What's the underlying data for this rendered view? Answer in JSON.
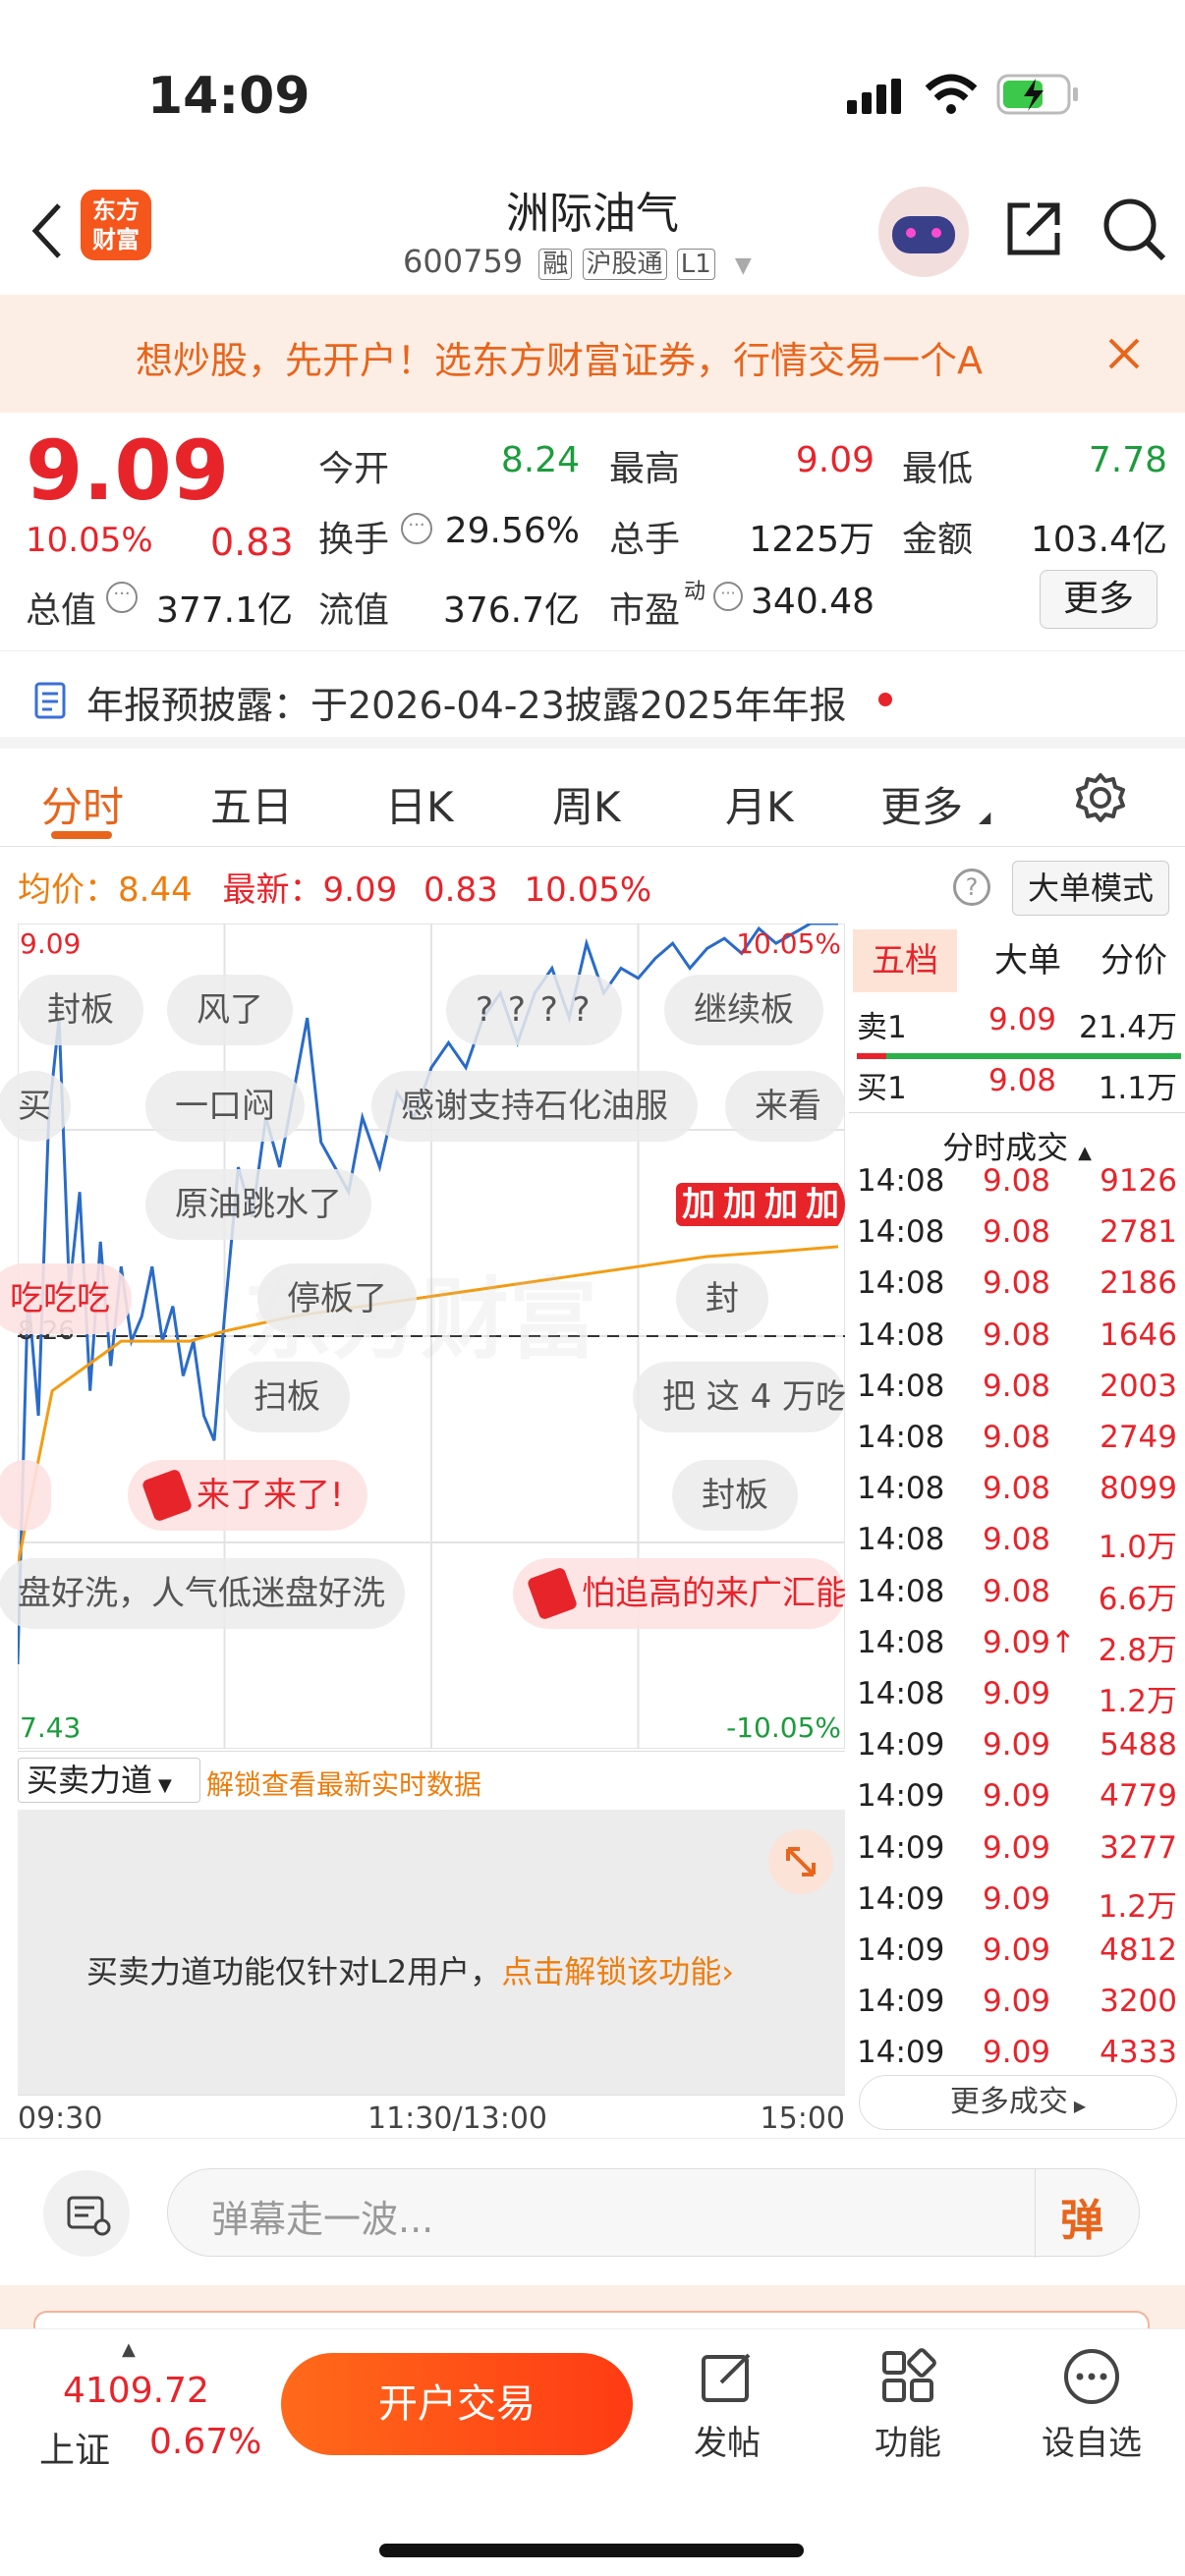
{
  "status": {
    "time": "14:09"
  },
  "header": {
    "title": "洲际油气",
    "code": "600759",
    "tags": [
      "融",
      "沪股通",
      "L1"
    ],
    "logo": "东方财富"
  },
  "banner": {
    "text": "想炒股，先开户！选东方财富证券，行情交易一个A"
  },
  "quote": {
    "price": "9.09",
    "pct": "10.05%",
    "change": "0.83",
    "fields": [
      {
        "label": "今开",
        "value": "8.24",
        "color": "#1c9c3c"
      },
      {
        "label": "最高",
        "value": "9.09",
        "color": "#e8242b"
      },
      {
        "label": "最低",
        "value": "7.78",
        "color": "#1c9c3c"
      },
      {
        "label": "换手",
        "value": "29.56%",
        "color": "#222"
      },
      {
        "label": "总手",
        "value": "1225万",
        "color": "#222"
      },
      {
        "label": "金额",
        "value": "103.4亿",
        "color": "#222"
      },
      {
        "label": "总值",
        "value": "377.1亿",
        "color": "#222"
      },
      {
        "label": "流值",
        "value": "376.7亿",
        "color": "#222"
      },
      {
        "label": "市盈",
        "value": "340.48",
        "color": "#222",
        "sup": "动"
      }
    ],
    "more": "更多"
  },
  "notice": {
    "text": "年报预披露：于2026-04-23披露2025年年报"
  },
  "tabs": [
    "分时",
    "五日",
    "日K",
    "周K",
    "月K",
    "更多"
  ],
  "chartinfo": {
    "avg_label": "均价：",
    "avg": "8.44",
    "new_label": "最新：",
    "new": "9.09",
    "chg": "0.83",
    "pct": "10.05%",
    "mode": "大单模式",
    "hi": "9.09",
    "lo": "7.43",
    "hipct": "10.05%",
    "lopct": "-10.05%",
    "mid": "8.26",
    "watermark": "东方财富",
    "xlabels": [
      "09:30",
      "11:30/13:00",
      "15:00"
    ]
  },
  "chart_data": {
    "type": "line",
    "x_range": [
      "09:30",
      "15:00"
    ],
    "ylim": [
      7.43,
      9.09
    ],
    "reference": 8.26,
    "series": [
      {
        "x": [
          0,
          3,
          6,
          9,
          12,
          15,
          18,
          21,
          24,
          27,
          30,
          33,
          36,
          39,
          42,
          45,
          48,
          51,
          54,
          57,
          60,
          64,
          68,
          72,
          76,
          80,
          84,
          88,
          92,
          96,
          100,
          105,
          110,
          115,
          120,
          125,
          130,
          135,
          140,
          145,
          150,
          155,
          160,
          165,
          170,
          175,
          180,
          185,
          190,
          195,
          200,
          205,
          210,
          215,
          220,
          225,
          230,
          235,
          238
        ],
        "values": [
          7.6,
          8.35,
          8.1,
          8.7,
          8.9,
          8.35,
          8.55,
          8.15,
          8.45,
          8.2,
          8.4,
          8.25,
          8.3,
          8.4,
          8.25,
          8.32,
          8.18,
          8.25,
          8.1,
          8.05,
          8.3,
          8.6,
          8.5,
          8.7,
          8.6,
          8.75,
          8.9,
          8.65,
          8.6,
          8.55,
          8.7,
          8.6,
          8.75,
          8.7,
          8.8,
          8.85,
          8.8,
          8.9,
          8.95,
          8.85,
          8.95,
          9.0,
          8.9,
          9.05,
          8.95,
          9.0,
          8.98,
          9.02,
          9.05,
          9.0,
          9.04,
          9.06,
          9.03,
          9.08,
          9.05,
          9.07,
          9.09,
          9.09,
          9.09
        ]
      },
      {
        "x": [
          0,
          10,
          20,
          30,
          40,
          50,
          60,
          80,
          100,
          120,
          140,
          160,
          180,
          200,
          220,
          238
        ],
        "values": [
          7.8,
          8.15,
          8.2,
          8.25,
          8.25,
          8.25,
          8.27,
          8.3,
          8.32,
          8.34,
          8.36,
          8.38,
          8.4,
          8.42,
          8.43,
          8.44
        ]
      }
    ]
  },
  "danmu": [
    "封板",
    "风了",
    "? ? ? ?",
    "继续板",
    "买",
    "一口闷",
    "感谢支持石化油服",
    "来看",
    "原油跳水了",
    "加加加加",
    "吃吃吃",
    "停板了",
    "封",
    "扫板",
    "把 这 4 万吃",
    "来了来了!",
    "封板",
    "盘好洗，人气低迷盘好洗",
    "怕追高的来广汇能"
  ],
  "force": {
    "label": "买卖力道",
    "unlock": "解锁查看最新实时数据",
    "msg": "买卖力道功能仅针对L2用户，",
    "link": "点击解锁该功能"
  },
  "orderbook": {
    "tabs": [
      "五档",
      "大单",
      "分价"
    ],
    "sell": {
      "label": "卖1",
      "price": "9.09",
      "vol": "21.4万"
    },
    "buy": {
      "label": "买1",
      "price": "9.08",
      "vol": "1.1万"
    },
    "trades_title": "分时成交",
    "trades": [
      [
        "14:08",
        "9.08",
        "9126"
      ],
      [
        "14:08",
        "9.08",
        "2781"
      ],
      [
        "14:08",
        "9.08",
        "2186"
      ],
      [
        "14:08",
        "9.08",
        "1646"
      ],
      [
        "14:08",
        "9.08",
        "2003"
      ],
      [
        "14:08",
        "9.08",
        "2749"
      ],
      [
        "14:08",
        "9.08",
        "8099"
      ],
      [
        "14:08",
        "9.08",
        "1.0万"
      ],
      [
        "14:08",
        "9.08",
        "6.6万"
      ],
      [
        "14:08",
        "9.09↑",
        "2.8万"
      ],
      [
        "14:08",
        "9.09",
        "1.2万"
      ],
      [
        "14:09",
        "9.09",
        "5488"
      ],
      [
        "14:09",
        "9.09",
        "4779"
      ],
      [
        "14:09",
        "9.09",
        "3277"
      ],
      [
        "14:09",
        "9.09",
        "1.2万"
      ],
      [
        "14:09",
        "9.09",
        "4812"
      ],
      [
        "14:09",
        "9.09",
        "3200"
      ],
      [
        "14:09",
        "9.09",
        "4333"
      ]
    ],
    "more": "更多成交"
  },
  "danmu_input": {
    "placeholder": "弹幕走一波...",
    "btn": "弹"
  },
  "bottom": {
    "index_value": "4109.72",
    "index_name": "上证",
    "index_pct": "0.67%",
    "trade": "开户交易",
    "items": [
      "发帖",
      "功能",
      "设自选"
    ]
  }
}
